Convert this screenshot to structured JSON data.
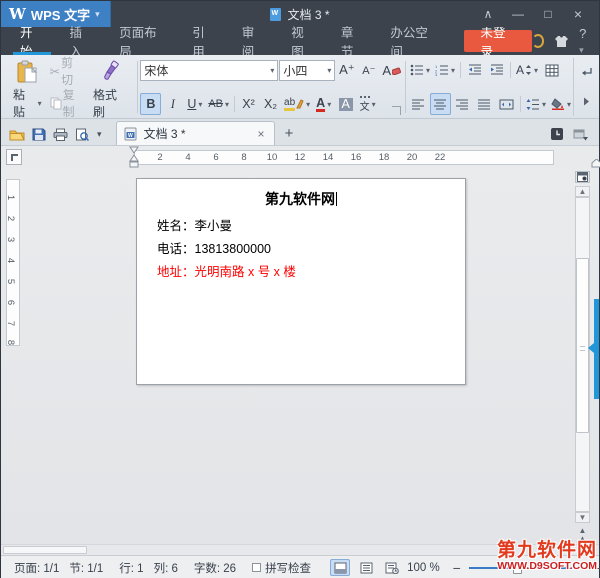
{
  "colors": {
    "accent_blue": "#3e80c4",
    "tab_underline": "#2196d8",
    "login_red": "#e8593f",
    "address_red": "#ff0000",
    "watermark_red": "#e23a1e",
    "watermark_url_red": "#cc2020"
  },
  "icons": {
    "dropdown": "▾",
    "collapse": "∧",
    "minimize": "—",
    "maximize": "□",
    "close": "×",
    "plus": "+",
    "minus": "−",
    "scissors": "✂",
    "up_arrow": "▲",
    "down_arrow": "▼",
    "prev_page": "▲▲",
    "shirt": "👕",
    "help": "?"
  },
  "title_bar": {
    "app_label": "WPS 文字",
    "doc_title": "文档 3 *"
  },
  "menu": {
    "tabs": [
      "开始",
      "插入",
      "页面布局",
      "引用",
      "审阅",
      "视图",
      "章节",
      "办公空间"
    ],
    "active_tab": "开始",
    "login_label": "未登录"
  },
  "ribbon": {
    "paste_label": "粘贴",
    "cut_label": "剪切",
    "copy_label": "复制",
    "format_painter_label": "格式刷",
    "font_name": "宋体",
    "font_size": "小四",
    "grow_font_label": "A⁺",
    "shrink_font_label": "A⁻",
    "clear_format_label": "A",
    "bold_label": "B",
    "italic_label": "I",
    "underline_label": "U",
    "strike_label": "AB",
    "superscript_label": "X²",
    "subscript_label": "X₂",
    "highlight_label": "ab",
    "font_color_label": "A",
    "char_shade_label": "A",
    "pinyin_label": "文",
    "char_scale_label": "A"
  },
  "doc_tab": {
    "title": "文档 3 *"
  },
  "ruler": {
    "h": [
      "2",
      "4",
      "6",
      "8",
      "10",
      "12",
      "14",
      "16",
      "18",
      "20",
      "22"
    ],
    "v": [
      "1",
      "2",
      "3",
      "4",
      "5",
      "6",
      "7",
      "8"
    ]
  },
  "document": {
    "title": "第九软件网",
    "lines": [
      {
        "text": "姓名：李小曼",
        "color": "#000000"
      },
      {
        "text": "电话：13813800000",
        "color": "#000000"
      },
      {
        "text": "地址：光明南路 x 号 x 楼",
        "color": "#ff0000"
      }
    ]
  },
  "status_bar": {
    "page": "页面: 1/1",
    "section": "节: 1/1",
    "line": "行: 1",
    "column": "列: 6",
    "words": "字数: 26",
    "spell_check": "拼写检查",
    "zoom_level": "100 %"
  },
  "watermark": {
    "title": "第九软件网",
    "url": "WWW.D9SOFT.COM"
  }
}
